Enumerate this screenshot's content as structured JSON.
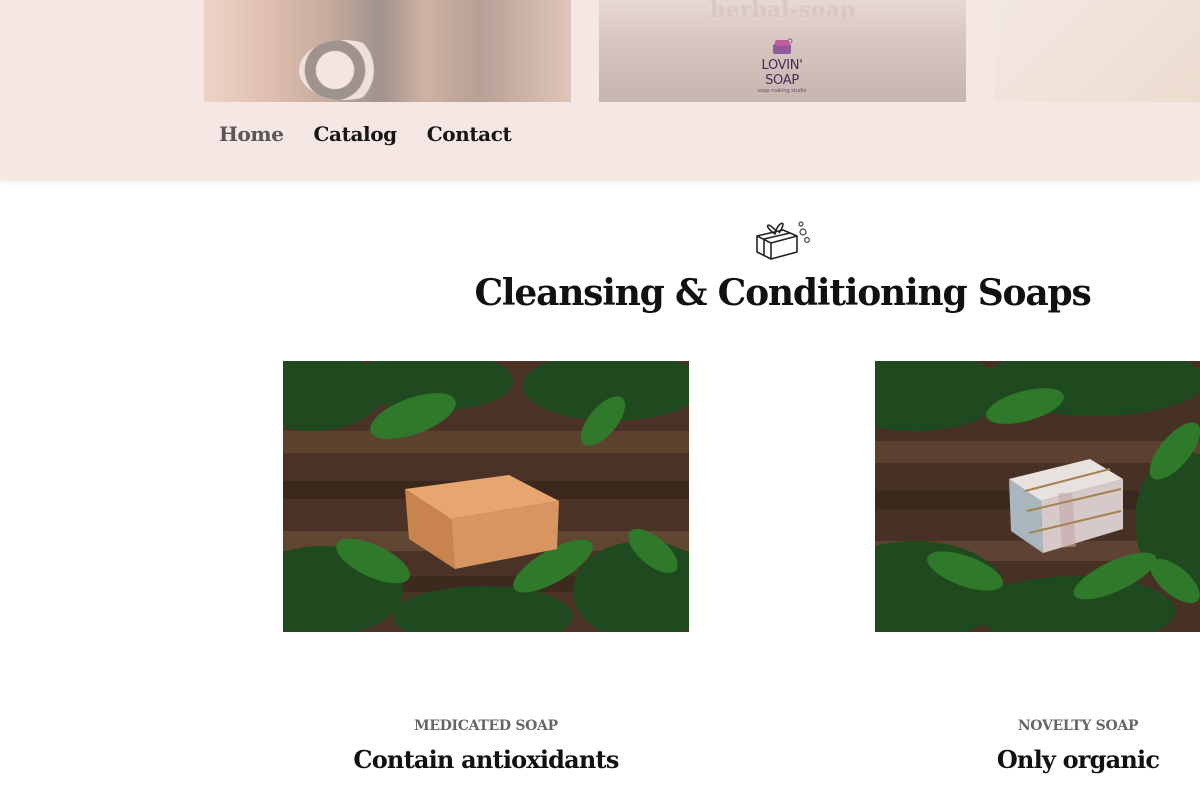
{
  "header": {
    "hero_label": "herbal-soap",
    "logo": {
      "name": "LOVIN' SOAP",
      "sub": "soap making studio"
    },
    "nav": [
      {
        "label": "Home",
        "active": true
      },
      {
        "label": "Catalog",
        "active": false
      },
      {
        "label": "Contact",
        "active": false
      }
    ]
  },
  "section": {
    "icon": "gift-soap-icon",
    "title": "Cleansing & Conditioning Soaps"
  },
  "products": [
    {
      "category": "MEDICATED SOAP",
      "tagline": "Contain antioxidants"
    },
    {
      "category": "NOVELTY SOAP",
      "tagline": "Only organic"
    }
  ],
  "colors": {
    "header_bg": "#f4e7e4",
    "text_dark": "#111111",
    "nav_active": "#5b5757",
    "category_gray": "#666666"
  }
}
